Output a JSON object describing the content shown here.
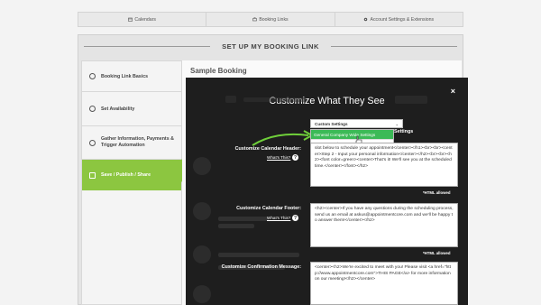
{
  "topnav": {
    "calendars": "Calendars",
    "booking_links": "Booking Links",
    "account_settings": "Account Settings & Extensions"
  },
  "panel_title": "SET UP MY BOOKING LINK",
  "sidebar": {
    "items": [
      {
        "label": "Booking Link Basics"
      },
      {
        "label": "Set Availability"
      },
      {
        "label": "Gather Information, Payments & Trigger Automation"
      },
      {
        "label": "Save / Publish / Share"
      }
    ]
  },
  "content": {
    "title": "Sample Booking"
  },
  "modal": {
    "title": "Customize What They See",
    "close": "×",
    "select_value": "Custom Settings",
    "dropdown_options": [
      "General Company Wide Settings",
      "Custom Settings"
    ],
    "settings_word": "Settings",
    "fields": [
      {
        "label": "Customize Calendar Header:",
        "whats_this": "What's This?",
        "value": "slot below to schedule your appointment</center></h1><br><br><center>Step 2 - Input your personal information</center></h2><br><br><h2><font color=green><center>That's it! We'll see you at the scheduled time.</center></font></h2>",
        "allowed": "*HTML allowed"
      },
      {
        "label": "Customize Calendar Footer:",
        "whats_this": "What's This?",
        "value": "<h2><center>If you have any questions during the scheduling process, send us an email at askus@appointmentcore.com and we'll be happy to answer them!</center></h2>",
        "allowed": "*HTML allowed"
      },
      {
        "label": "Customize Confirmation Message:",
        "value": "<center><h2>We're excited to meet with you! Please visit <a href=\"http://www.appointmentcore.com\">THIS PAGE</a> for more information on our meeting!</h2></center>"
      }
    ]
  }
}
